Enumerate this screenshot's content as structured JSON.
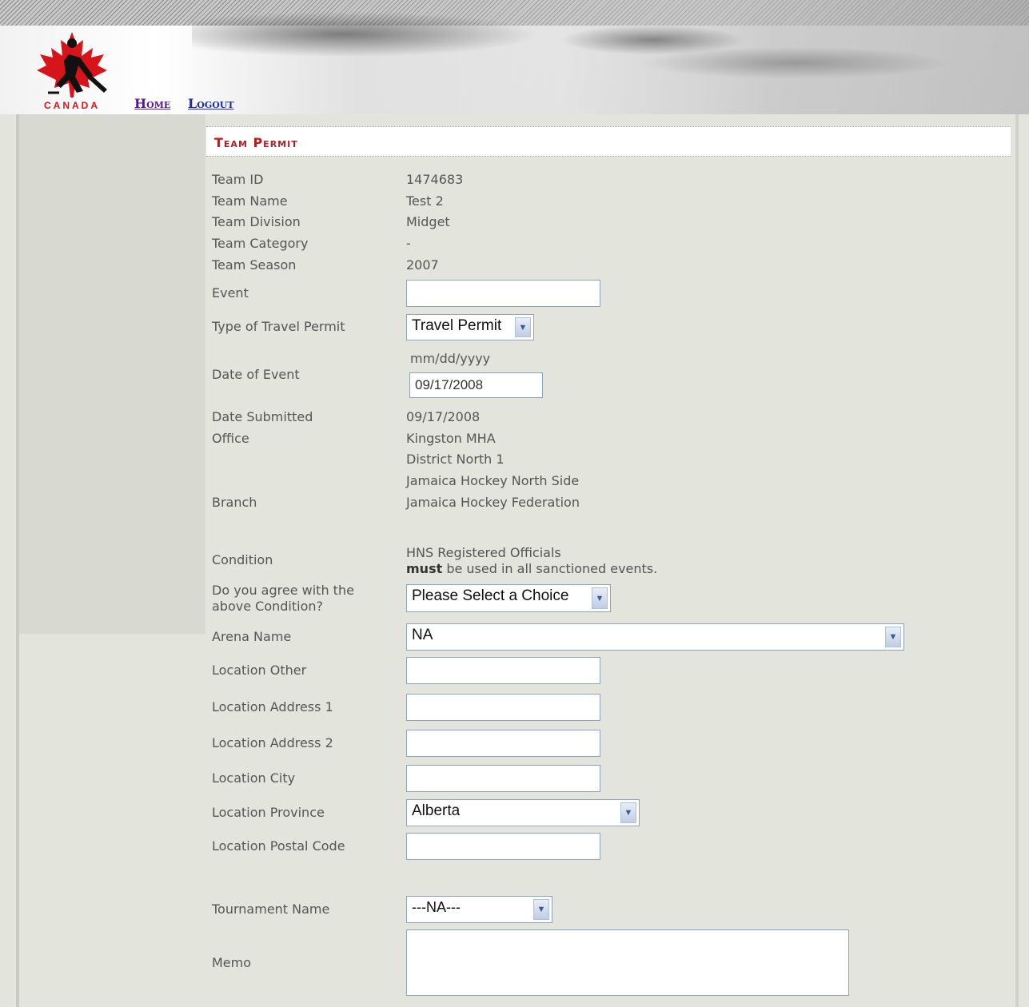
{
  "header": {
    "logo_text": "CANADA",
    "nav": {
      "home": "Home",
      "logout": "Logout"
    }
  },
  "title": "Team Permit",
  "fields": {
    "team_id": {
      "label": "Team ID",
      "value": "1474683"
    },
    "team_name": {
      "label": "Team Name",
      "value": "Test 2"
    },
    "team_division": {
      "label": "Team Division",
      "value": "Midget"
    },
    "team_category": {
      "label": "Team Category",
      "value": "-"
    },
    "team_season": {
      "label": "Team Season",
      "value": "2007"
    },
    "event": {
      "label": "Event",
      "value": ""
    },
    "travel_permit_type": {
      "label": "Type of Travel Permit",
      "selected": "Travel Permit"
    },
    "date_of_event": {
      "label": "Date of Event",
      "hint": "mm/dd/yyyy",
      "value": "09/17/2008"
    },
    "date_submitted": {
      "label": "Date Submitted",
      "value": "09/17/2008"
    },
    "office": {
      "label": "Office",
      "lines": [
        "Kingston MHA",
        "District North 1",
        "Jamaica Hockey North Side"
      ]
    },
    "branch": {
      "label": "Branch",
      "value": "Jamaica Hockey Federation"
    },
    "condition": {
      "label": "Condition",
      "line1": "HNS Registered Officials",
      "line2_bold": "must",
      "line2_rest": " be used in all sanctioned events."
    },
    "agree": {
      "label_line1": "Do you agree with the",
      "label_line2": "above Condition?",
      "selected": "Please Select a Choice"
    },
    "arena_name": {
      "label": "Arena Name",
      "selected": "NA"
    },
    "location_other": {
      "label": "Location Other",
      "value": ""
    },
    "location_address_1": {
      "label": "Location Address 1",
      "value": ""
    },
    "location_address_2": {
      "label": "Location Address 2",
      "value": ""
    },
    "location_city": {
      "label": "Location City",
      "value": ""
    },
    "location_province": {
      "label": "Location Province",
      "selected": "Alberta"
    },
    "location_postal_code": {
      "label": "Location Postal Code",
      "value": ""
    },
    "tournament_name": {
      "label": "Tournament Name",
      "selected": "---NA---"
    },
    "memo": {
      "label": "Memo",
      "value": ""
    }
  },
  "colors": {
    "title_red": "#b51d23",
    "page_bg": "#e3e4dc",
    "sidebar_bg": "#d8d9d0",
    "input_border": "#8ea3bd",
    "logo_red": "#d7141a"
  },
  "icons": {
    "logo": "maple-leaf-hockey-player-logo",
    "dropdown": "chevron-down-icon"
  }
}
